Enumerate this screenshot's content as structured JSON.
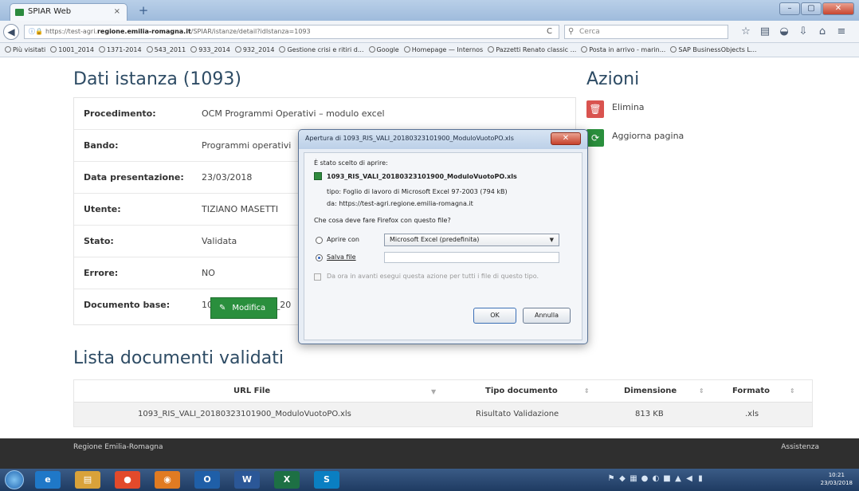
{
  "browser": {
    "tab_title": "SPIAR Web",
    "tab_close": "×",
    "new_tab": "+",
    "window_controls": {
      "minimize": "–",
      "maximize": "▢",
      "close": "✕"
    },
    "url_prefix": "https://test-agri.",
    "url_domain": "regione.emilia-romagna.it",
    "url_path": "/SPIAR/istanze/detail?idIstanza=1093",
    "search_placeholder": "Cerca",
    "bookmarks": [
      "Più visitati",
      "1001_2014",
      "1371-2014",
      "543_2011",
      "933_2014",
      "932_2014",
      "Gestione crisi e ritiri d...",
      "Google",
      "Homepage — Internos",
      "Pazzetti Renato classic ...",
      "Posta in arrivo - marin...",
      "SAP BusinessObjects L..."
    ]
  },
  "page": {
    "title": "Dati istanza (1093)",
    "details": [
      {
        "label": "Procedimento:",
        "value": "OCM Programmi Operativi – modulo excel"
      },
      {
        "label": "Bando:",
        "value": "Programmi operativi"
      },
      {
        "label": "Data presentazione:",
        "value": "23/03/2018"
      },
      {
        "label": "Utente:",
        "value": "TIZIANO MASETTI"
      },
      {
        "label": "Stato:",
        "value": "Validata"
      },
      {
        "label": "Errore:",
        "value": "NO"
      },
      {
        "label": "Documento base:",
        "value": "1093_DOC_BASE_20"
      }
    ],
    "modifica_label": "Modifica",
    "actions_title": "Azioni",
    "actions": [
      {
        "label": "Elimina",
        "color": "#d9534f"
      },
      {
        "label": "Aggiorna pagina",
        "color": "#2a8f3d"
      }
    ],
    "docs_title": "Lista documenti validati",
    "docs_table": {
      "headers": [
        "URL File",
        "Tipo documento",
        "Dimensione",
        "Formato"
      ],
      "rows": [
        [
          "1093_RIS_VALI_20180323101900_ModuloVuotoPO.xls",
          "Risultato Validazione",
          "813 KB",
          ".xls"
        ]
      ]
    },
    "footer_left": "Regione Emilia-Romagna",
    "footer_right": "Assistenza"
  },
  "dialog": {
    "title": "Apertura di 1093_RIS_VALI_20180323101900_ModuloVuotoPO.xls",
    "intro": "È stato scelto di aprire:",
    "filename": "1093_RIS_VALI_20180323101900_ModuloVuotoPO.xls",
    "type_line": "tipo: Foglio di lavoro di Microsoft Excel 97-2003 (794 kB)",
    "from_line": "da: https://test-agri.regione.emilia-romagna.it",
    "question": "Che cosa deve fare Firefox con questo file?",
    "open_with_label": "Aprire con",
    "open_with_value": "Microsoft Excel (predefinita)",
    "save_label": "Salva file",
    "remember_label": "Da ora in avanti esegui questa azione per tutti i file di questo tipo.",
    "ok_label": "OK",
    "cancel_label": "Annulla"
  },
  "taskbar": {
    "apps": [
      {
        "label": "e",
        "color": "#1f78c8"
      },
      {
        "label": "▤",
        "color": "#d9a23a"
      },
      {
        "label": "●",
        "color": "#e24a2b"
      },
      {
        "label": "◉",
        "color": "#e07b22"
      },
      {
        "label": "O",
        "color": "#1f5fa8"
      },
      {
        "label": "W",
        "color": "#2b5797"
      },
      {
        "label": "X",
        "color": "#1d7044"
      },
      {
        "label": "S",
        "color": "#0a7fc2"
      }
    ],
    "clock_time": "10:21",
    "clock_date": "23/03/2018"
  }
}
